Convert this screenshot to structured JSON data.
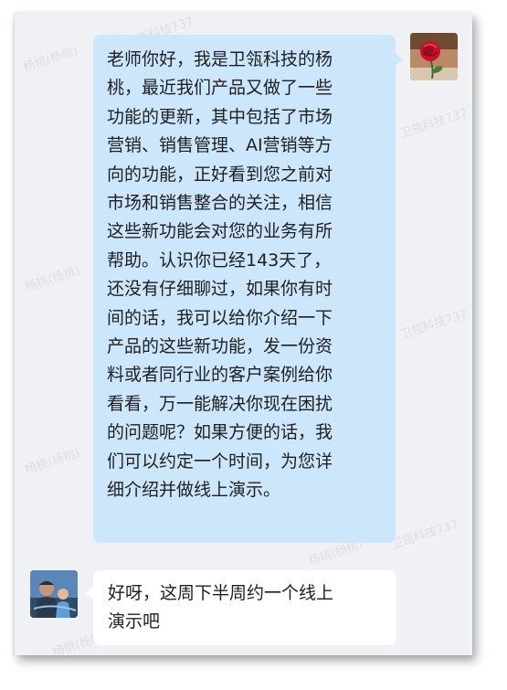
{
  "chat": {
    "messages": [
      {
        "sender": "self",
        "avatar_icon": "rose-avatar",
        "text": "老师你好，我是卫瓴科技的杨\n桃，最近我们产品又做了一些\n功能的更新，其中包括了市场\n营销、销售管理、AI营销等方\n向的功能，正好看到您之前对\n市场和销售整合的关注，相信\n这些新功能会对您的业务有所\n帮助。认识你已经143天了，\n还没有仔细聊过，如果你有时\n间的话，我可以给你介绍一下\n产品的这些新功能，发一份资\n料或者同行业的客户案例给你\n看看，万一能解决你现在困扰\n的问题呢？如果方便的话，我\n们可以约定一个时间，为您详\n细介绍并做线上演示。"
      },
      {
        "sender": "other",
        "avatar_icon": "parent-child-avatar",
        "text": "好呀，这周下半周约一个线上\n演示吧"
      }
    ]
  },
  "watermark": {
    "name": "杨桃(杨桃)",
    "company": "卫瓴科技737"
  },
  "colors": {
    "background": "#f0f1f5",
    "outgoing_bubble": "#cce6fc",
    "incoming_bubble": "#ffffff"
  }
}
